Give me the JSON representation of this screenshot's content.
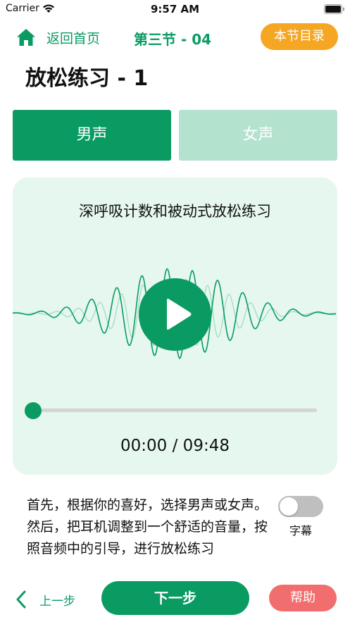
{
  "status_bar": {
    "carrier": "Carrier",
    "time": "9:57 AM"
  },
  "nav": {
    "home_label": "返回首页",
    "section_title": "第三节 - 04",
    "catalog_label": "本节目录"
  },
  "page_title": "放松练习 - 1",
  "voice_tabs": {
    "male": "男声",
    "female": "女声",
    "selected": "男声"
  },
  "player": {
    "track_title": "深呼吸计数和被动式放松练习",
    "time_readout": "00:00 / 09:48",
    "progress": 0
  },
  "instruction_text": "首先，根据你的喜好，选择男声或女声。然后，把耳机调整到一个舒适的音量，按照音频中的引导，进行放松练习",
  "subtitle": {
    "label": "字幕",
    "enabled": false
  },
  "bottom": {
    "prev_label": "上一步",
    "next_label": "下一步",
    "help_label": "帮助"
  },
  "colors": {
    "primary_green": "#0a9b63",
    "light_green_tab": "#b3e3cf",
    "card_background": "#e5f7ee",
    "catalog_orange": "#f5a623",
    "help_red": "#f26d6d",
    "toggle_off": "#bfbfbf"
  }
}
